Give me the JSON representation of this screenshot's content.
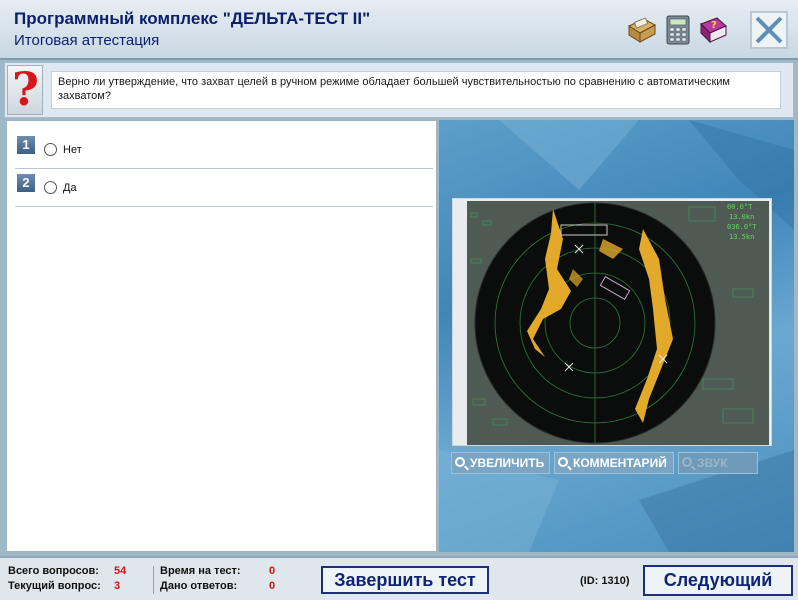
{
  "header": {
    "title": "Программный комплекс \"ДЕЛЬТА-ТЕСТ II\"",
    "subtitle": "Итоговая аттестация",
    "tools": [
      "database-icon",
      "calculator-icon",
      "help-book-icon"
    ],
    "close_icon": "close-icon"
  },
  "question": {
    "icon": "question-mark-icon",
    "icon_glyph": "?",
    "text": "Верно ли утверждение, что захват целей в ручном режиме обладает большей чувствительностью по сравнению с автоматическим захватом?"
  },
  "answers": [
    {
      "number": "1",
      "label": "Нет",
      "selected": false
    },
    {
      "number": "2",
      "label": "Да",
      "selected": false
    }
  ],
  "image_panel": {
    "buttons": [
      {
        "label": "УВЕЛИЧИТЬ",
        "enabled": true
      },
      {
        "label": "КОММЕНТАРИЙ",
        "enabled": true
      },
      {
        "label": "ЗВУК",
        "enabled": false
      }
    ]
  },
  "footer": {
    "total_questions_label": "Всего вопросов:",
    "total_questions_value": "54",
    "current_question_label": "Текущий вопрос:",
    "current_question_value": "3",
    "time_label": "Время на тест:",
    "time_value": "0",
    "answers_given_label": "Дано ответов:",
    "answers_given_value": "0",
    "finish_button": "Завершить тест",
    "id_text": "(ID: 1310)",
    "next_button": "Следующий"
  },
  "colors": {
    "title": "#0c1f6e",
    "accent_red": "#d0141b",
    "panel_blue": "#4a8fbf",
    "radar_echo": "#e8b020"
  }
}
